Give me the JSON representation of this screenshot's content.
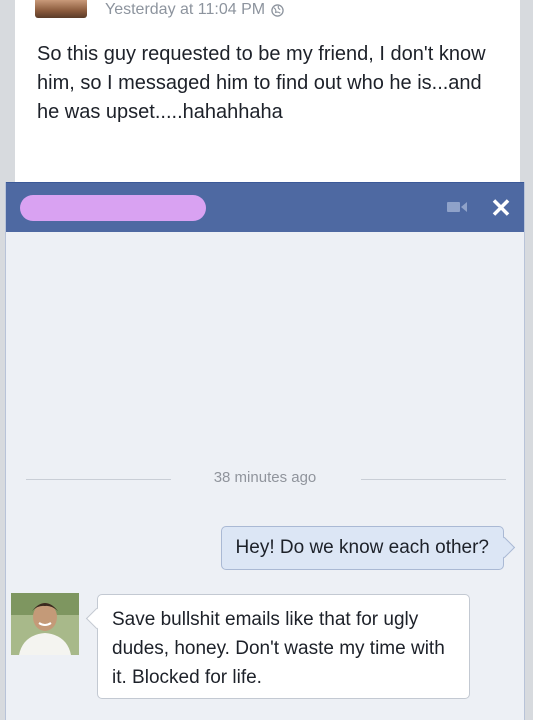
{
  "post": {
    "timestamp": "Yesterday at 11:04 PM",
    "privacy_icon": "globe-icon",
    "text": "So this guy requested to be my friend, I don't know him, so I messaged him to find out who he is...and he was upset.....hahahhaha"
  },
  "chat": {
    "header": {
      "name_redacted": true,
      "redaction_color": "#d9a2f2",
      "header_color": "#4e69a2",
      "video_icon": "video-camera-icon",
      "close_label": "✕"
    },
    "divider_timestamp": "38 minutes ago",
    "messages": [
      {
        "direction": "outgoing",
        "text": "Hey! Do we know each other?"
      },
      {
        "direction": "incoming",
        "text": "Save bullshit emails like that for ugly dudes, honey. Don't waste my time with it. Blocked for life."
      }
    ]
  }
}
